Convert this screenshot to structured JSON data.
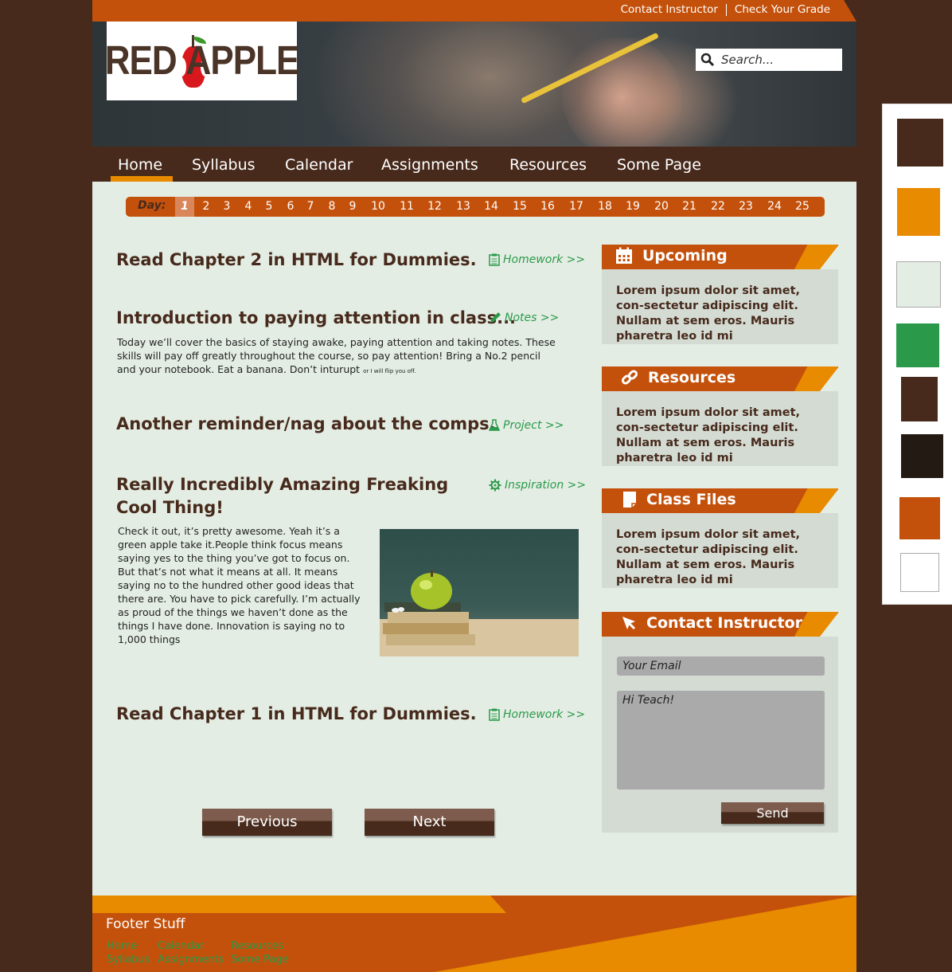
{
  "topbar": {
    "links": [
      "Contact Instructor",
      "Check Your Grade"
    ]
  },
  "logo": {
    "left_word": "RED",
    "right_word": "APPLE"
  },
  "search": {
    "placeholder": "Search..."
  },
  "nav": {
    "items": [
      "Home",
      "Syllabus",
      "Calendar",
      "Assignments",
      "Resources",
      "Some Page"
    ],
    "active": "Home"
  },
  "days": {
    "label": "Day:",
    "items": [
      "1",
      "2",
      "3",
      "4",
      "5",
      "6",
      "7",
      "8",
      "9",
      "10",
      "11",
      "12",
      "13",
      "14",
      "15",
      "16",
      "17",
      "18",
      "19",
      "20",
      "21",
      "22",
      "23",
      "24",
      "25"
    ],
    "active": "1"
  },
  "items": [
    {
      "title": "Read Chapter 2 in HTML for Dummies.",
      "link": "Homework >>",
      "icon": "clipboard-icon"
    },
    {
      "title": "Introduction to paying attention in class...",
      "link": "Notes >>",
      "icon": "pencil-icon",
      "desc": "Today we’ll cover the basics of staying awake, paying attention and taking notes. These skills will pay off greatly throughout the course, so pay attention! Bring a No.2 pencil and your notebook. Eat a banana. Don’t inturupt",
      "desc_small": "or I will flip you off."
    },
    {
      "title": "Another reminder/nag about the comps.",
      "link": "Project >>",
      "icon": "flask-icon"
    },
    {
      "title_line1": "Really Incredibly Amazing Freaking",
      "title_line2": "Cool Thing!",
      "link": "Inspiration >>",
      "icon": "gear-icon",
      "desc": "Check it out, it’s pretty awesome. Yeah it’s a green apple take it.People think focus means saying yes to the thing you’ve got to focus on. But that’s not what it means at all. It means saying no to the hundred other good ideas that there are. You have to pick carefully. I’m actually as proud of the things we haven’t done as the things I have done. Innovation is saying no to 1,000 things"
    },
    {
      "title": "Read Chapter 1 in HTML for Dummies.",
      "link": "Homework >>",
      "icon": "clipboard-icon"
    }
  ],
  "pager": {
    "previous": "Previous",
    "next": "Next"
  },
  "sidebar": {
    "upcoming": {
      "title": "Upcoming",
      "icon": "calendar-icon",
      "body": "Lorem ipsum dolor sit amet, con-sectetur adipiscing elit. Nullam at sem eros. Mauris pharetra leo id mi"
    },
    "resources": {
      "title": "Resources",
      "icon": "link-icon",
      "body": "Lorem ipsum dolor sit amet, con-sectetur adipiscing elit. Nullam at sem eros. Mauris pharetra leo id mi"
    },
    "files": {
      "title": "Class Files",
      "icon": "file-icon",
      "body": "Lorem ipsum dolor sit amet, con-sectetur adipiscing elit. Nullam at sem eros. Mauris pharetra leo id mi"
    },
    "contact": {
      "title": "Contact Instructor",
      "icon": "cursor-icon",
      "email_placeholder": "Your Email",
      "message_placeholder": "Hi Teach!",
      "send": "Send"
    }
  },
  "footer": {
    "title": "Footer Stuff",
    "links": [
      "Home",
      "Calendar",
      "Resources",
      "Syllabus",
      "Assignments",
      "Some Page"
    ]
  },
  "palette": [
    "#472a1c",
    "#e88b00",
    "#e4ede4",
    "#2a9a4a",
    "#472a1c",
    "#241a14",
    "#c4510b",
    "#ffffff"
  ]
}
